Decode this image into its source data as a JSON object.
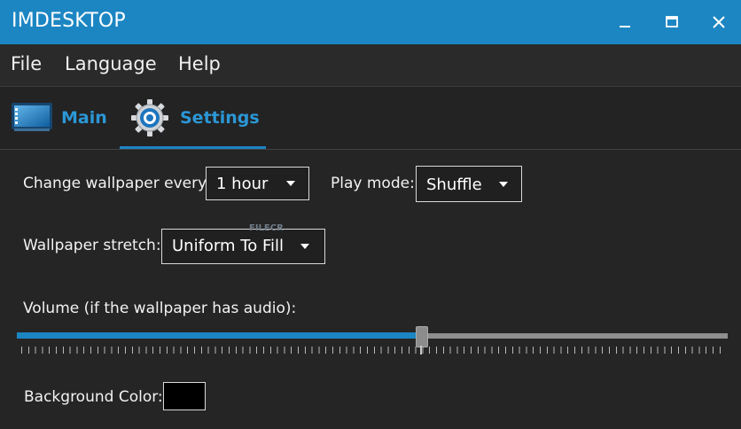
{
  "window": {
    "title": "IMDESKTOP"
  },
  "menu": [
    {
      "label": "File"
    },
    {
      "label": "Language"
    },
    {
      "label": "Help"
    }
  ],
  "tabs": [
    {
      "label": "Main",
      "icon": "monitor-icon"
    },
    {
      "label": "Settings",
      "icon": "gear-icon",
      "active": true
    }
  ],
  "settings": {
    "change_label": "Change wallpaper every:",
    "change_value": "1 hour",
    "play_mode_label": "Play mode:",
    "play_mode_value": "Shuffle",
    "stretch_label": "Wallpaper stretch:",
    "stretch_value": "Uniform To Fill",
    "volume_label": "Volume (if the wallpaper has audio):",
    "volume_fraction": 0.57,
    "background_label": "Background Color:",
    "background_color": "#000000"
  },
  "watermark": "FILECR",
  "colors": {
    "accent": "#1c86c3",
    "tab_text": "#2b97d6",
    "background": "#252526"
  }
}
